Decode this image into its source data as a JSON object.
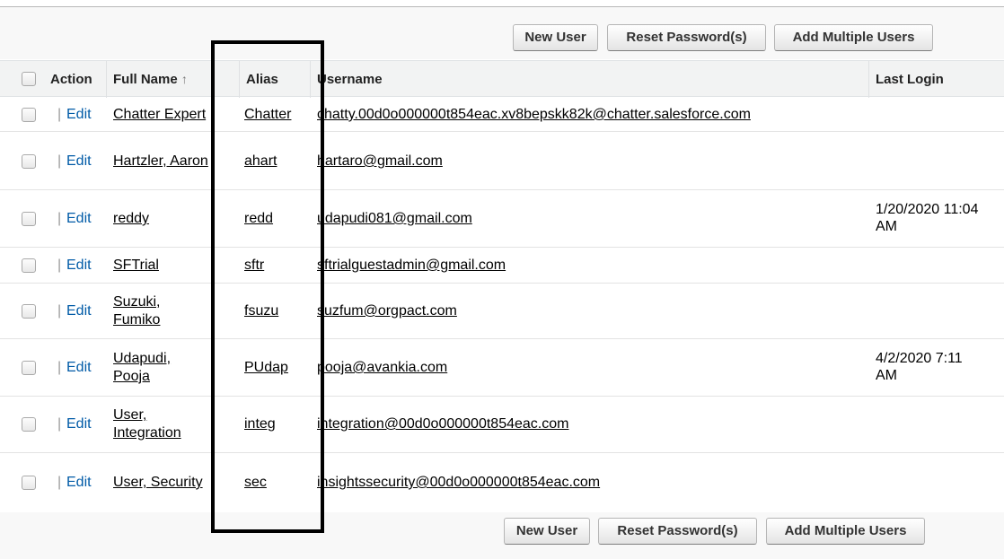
{
  "toolbar_top": {
    "new_user": "New User",
    "reset_password": "Reset Password(s)",
    "add_multiple": "Add Multiple Users"
  },
  "toolbar_bottom": {
    "new_user": "New User",
    "reset_password": "Reset Password(s)",
    "add_multiple": "Add Multiple Users"
  },
  "table": {
    "columns": {
      "action": "Action",
      "full_name": "Full Name",
      "full_name_sort": "↑",
      "alias": "Alias",
      "username": "Username",
      "last_login": "Last Login"
    },
    "rows": [
      {
        "edit": "Edit",
        "sep": "|",
        "name1": "Chatter Expert",
        "name2": "",
        "alias": "Chatter",
        "username": "chatty.00d0o000000t854eac.xv8bepskk82k@chatter.salesforce.com",
        "login1": "",
        "login2": ""
      },
      {
        "edit": "Edit",
        "sep": "|",
        "name1": "Hartzler, Aaron",
        "name2": "",
        "alias": "ahart",
        "username": "hartaro@gmail.com",
        "login1": "",
        "login2": ""
      },
      {
        "edit": "Edit",
        "sep": "|",
        "name1": "reddy",
        "name2": "",
        "alias": "redd",
        "username": "udapudi081@gmail.com",
        "login1": "1/20/2020 11:04",
        "login2": "AM"
      },
      {
        "edit": "Edit",
        "sep": "|",
        "name1": "SFTrial",
        "name2": "",
        "alias": "sftr",
        "username": "sftrialguestadmin@gmail.com",
        "login1": "",
        "login2": ""
      },
      {
        "edit": "Edit",
        "sep": "|",
        "name1": "Suzuki,",
        "name2": "Fumiko",
        "alias": "fsuzu",
        "username": "suzfum@orgpact.com",
        "login1": "",
        "login2": ""
      },
      {
        "edit": "Edit",
        "sep": "|",
        "name1": "Udapudi,",
        "name2": "Pooja",
        "alias": "PUdap",
        "username": "pooja@avankia.com",
        "login1": "4/2/2020 7:11",
        "login2": "AM"
      },
      {
        "edit": "Edit",
        "sep": "|",
        "name1": "User,",
        "name2": "Integration",
        "alias": "integ",
        "username": "integration@00d0o000000t854eac.com",
        "login1": "",
        "login2": ""
      },
      {
        "edit": "Edit",
        "sep": "|",
        "name1": "User, Security",
        "name2": "",
        "alias": "sec",
        "username": "insightssecurity@00d0o000000t854eac.com",
        "login1": "",
        "login2": ""
      }
    ]
  },
  "annotation": {
    "highlight_color": "#000000"
  }
}
